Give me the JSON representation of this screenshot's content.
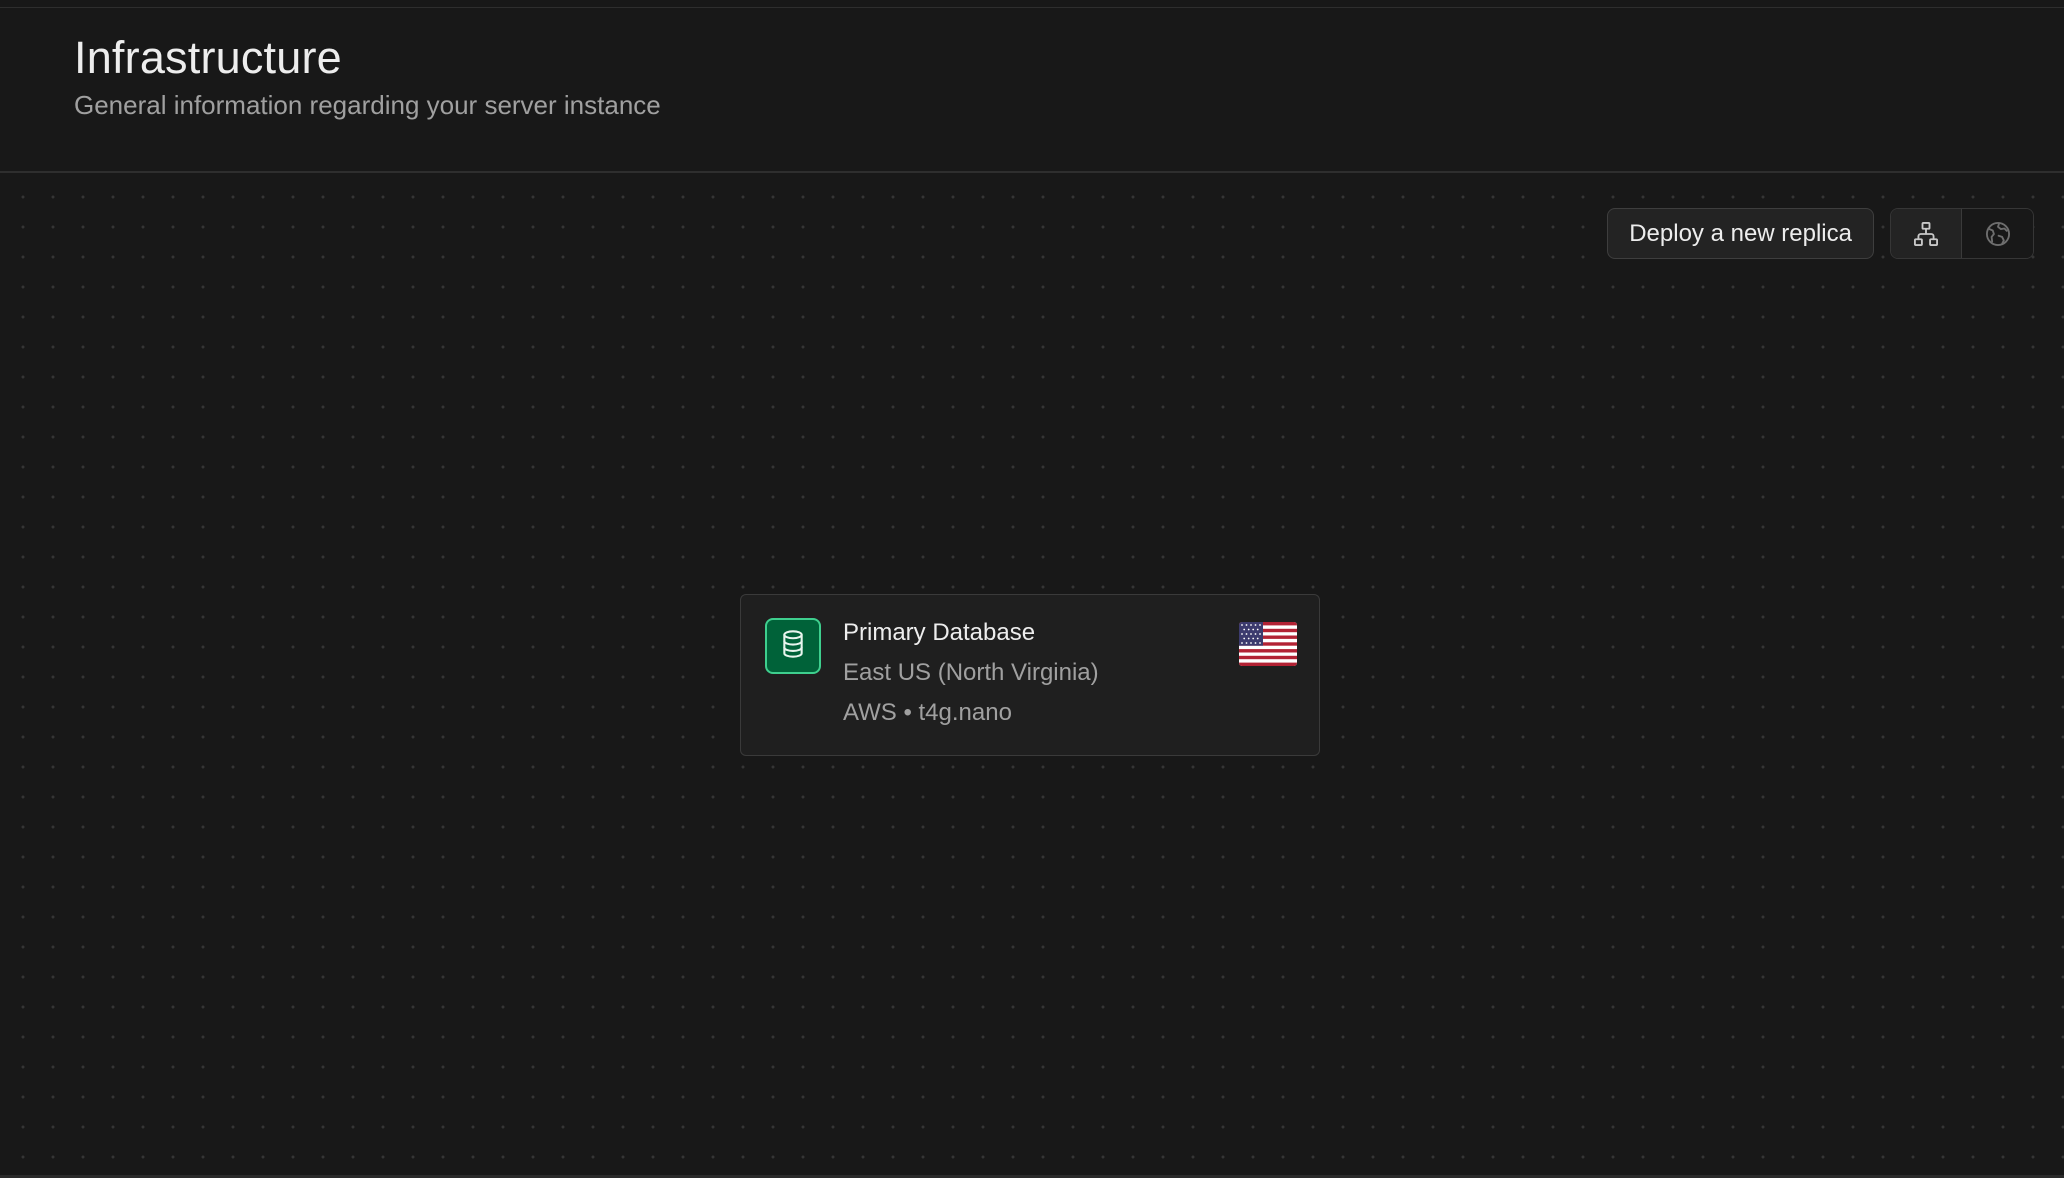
{
  "header": {
    "title": "Infrastructure",
    "subtitle": "General information regarding your server instance"
  },
  "toolbar": {
    "deploy_label": "Deploy a new replica",
    "view_toggle": [
      {
        "icon": "network-diagram-icon",
        "active": true
      },
      {
        "icon": "globe-icon",
        "active": false
      }
    ]
  },
  "database_card": {
    "icon": "database-icon",
    "name": "Primary Database",
    "region": "East US (North Virginia)",
    "provider": "AWS",
    "instance_type": "t4g.nano",
    "meta": "AWS • t4g.nano",
    "flag": "us-flag-icon"
  },
  "colors": {
    "background": "#181818",
    "card_background": "#1f1f1f",
    "accent_green": "#3ecf8e",
    "accent_green_dark": "#006239",
    "text_primary": "#ededed",
    "text_secondary": "#a0a0a0"
  }
}
